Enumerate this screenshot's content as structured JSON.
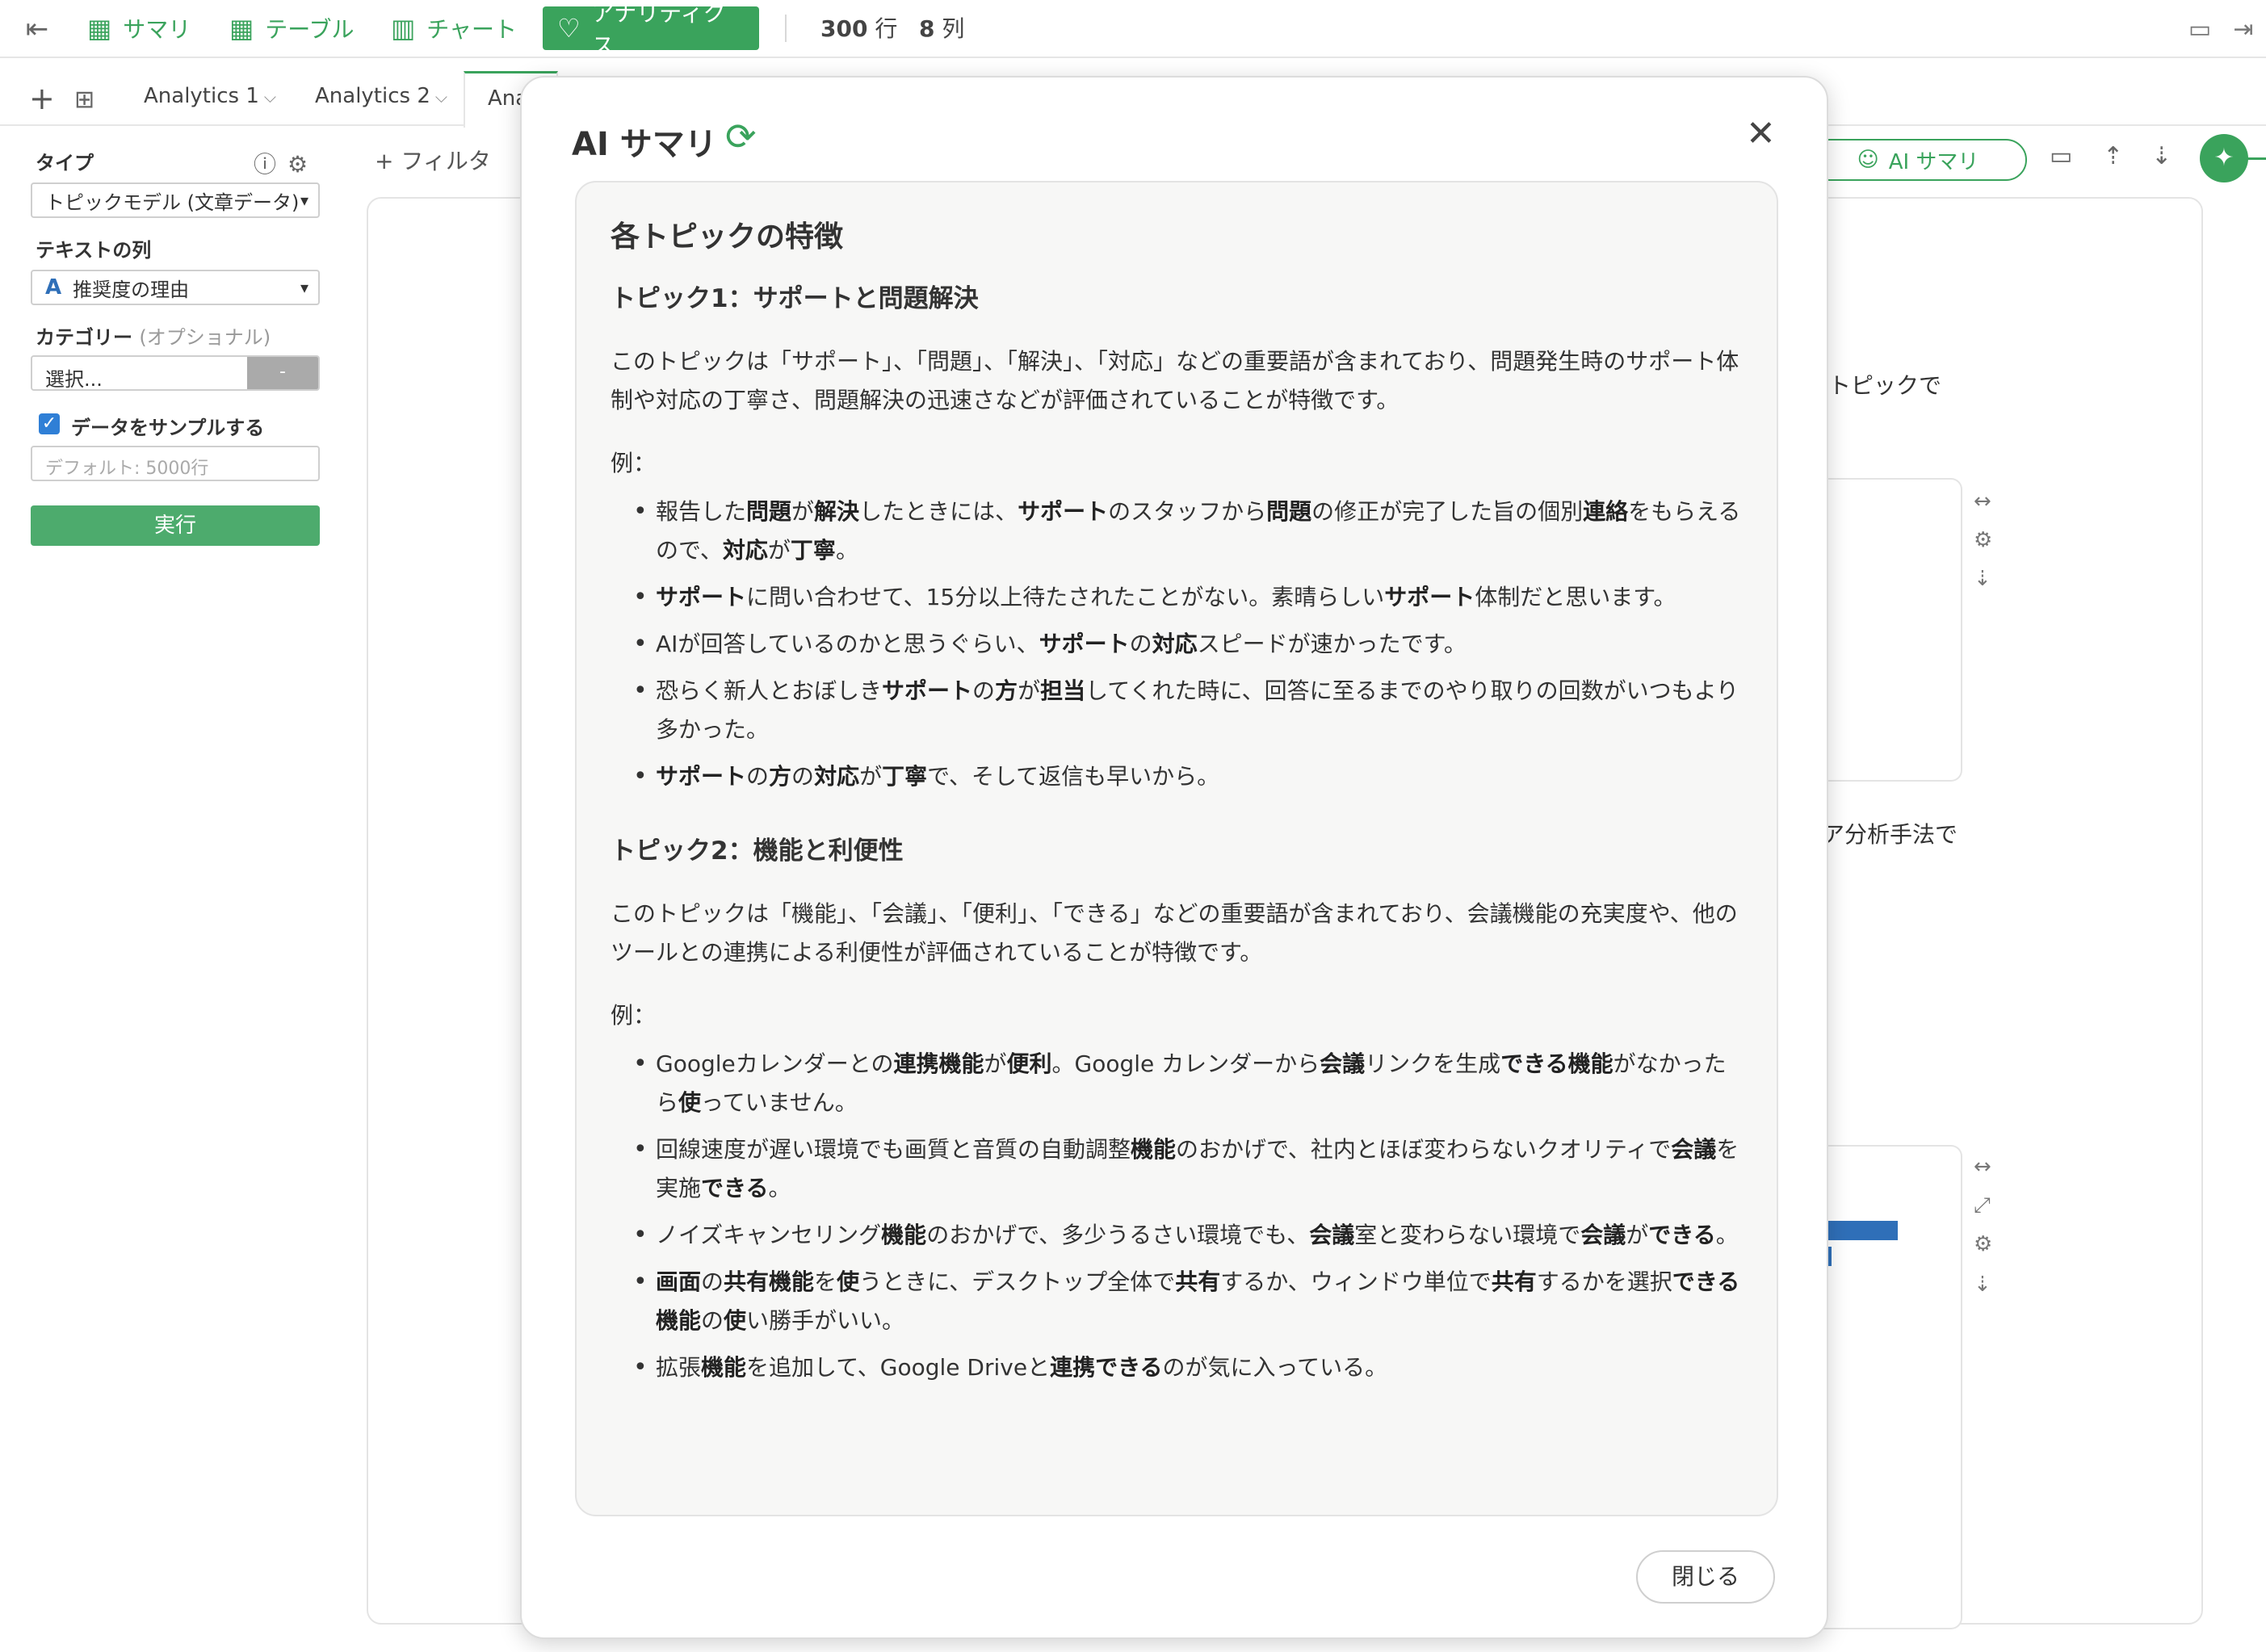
{
  "toolbar": {
    "tabs": [
      {
        "label": "サマリ",
        "icon": "table-icon"
      },
      {
        "label": "テーブル",
        "icon": "grid-icon"
      },
      {
        "label": "チャート",
        "icon": "bar-chart-icon"
      },
      {
        "label": "アナリティクス",
        "icon": "lightbulb-icon"
      }
    ],
    "rows": "300",
    "rows_unit": "行",
    "cols": "8",
    "cols_unit": "列"
  },
  "analytics_tabs": [
    "Analytics 1",
    "Analytics 2",
    "Anal"
  ],
  "config": {
    "type_label": "タイプ",
    "type_value": "トピックモデル (文章データ)",
    "text_col_label": "テキストの列",
    "text_col_value": "推奨度の理由",
    "category_label": "カテゴリー",
    "category_optional": "(オプショナル)",
    "category_placeholder": "選択...",
    "category_button": "-",
    "sample_label": "データをサンプルする",
    "sample_placeholder": "デフォルト: 5000行",
    "run_label": "実行"
  },
  "main": {
    "filter_label": "フィルタ",
    "ai_summary_button": "AI サマリ",
    "bg_text_1": "トピックで",
    "bg_text_2": "ア分析手法で"
  },
  "modal": {
    "title": "AI サマリ",
    "heading": "各トピックの特徴",
    "close_label": "閉じる",
    "topics": [
      {
        "title": "トピック1：サポートと問題解決",
        "desc": "このトピックは「サポート」、「問題」、「解決」、「対応」などの重要語が含まれており、問題発生時のサポート体制や対応の丁寧さ、問題解決の迅速さなどが評価されていることが特徴です。",
        "ex_label": "例：",
        "examples": [
          [
            [
              "報告した",
              false
            ],
            [
              "問題",
              true
            ],
            [
              "が",
              false
            ],
            [
              "解決",
              true
            ],
            [
              "したときには、",
              false
            ],
            [
              "サポート",
              true
            ],
            [
              "のスタッフから",
              false
            ],
            [
              "問題",
              true
            ],
            [
              "の修正が完了した旨の個別",
              false
            ],
            [
              "連絡",
              true
            ],
            [
              "をもらえるので、",
              false
            ],
            [
              "対応",
              true
            ],
            [
              "が",
              false
            ],
            [
              "丁寧",
              true
            ],
            [
              "。",
              false
            ]
          ],
          [
            [
              "サポート",
              true
            ],
            [
              "に問い合わせて、15分以上待たされたことがない。素晴らしい",
              false
            ],
            [
              "サポート",
              true
            ],
            [
              "体制だと思います。",
              false
            ]
          ],
          [
            [
              "AIが回答しているのかと思うぐらい、",
              false
            ],
            [
              "サポート",
              true
            ],
            [
              "の",
              false
            ],
            [
              "対応",
              true
            ],
            [
              "スピードが速かったです。",
              false
            ]
          ],
          [
            [
              "恐らく新人とおぼしき",
              false
            ],
            [
              "サポート",
              true
            ],
            [
              "の",
              false
            ],
            [
              "方",
              true
            ],
            [
              "が",
              false
            ],
            [
              "担当",
              true
            ],
            [
              "してくれた時に、回答に至るまでのやり取りの回数がいつもより多かった。",
              false
            ]
          ],
          [
            [
              "サポート",
              true
            ],
            [
              "の",
              false
            ],
            [
              "方",
              true
            ],
            [
              "の",
              false
            ],
            [
              "対応",
              true
            ],
            [
              "が",
              false
            ],
            [
              "丁寧",
              true
            ],
            [
              "で、そして返信も早いから。",
              false
            ]
          ]
        ]
      },
      {
        "title": "トピック2：機能と利便性",
        "desc": "このトピックは「機能」、「会議」、「便利」、「できる」などの重要語が含まれており、会議機能の充実度や、他のツールとの連携による利便性が評価されていることが特徴です。",
        "ex_label": "例：",
        "examples": [
          [
            [
              "Googleカレンダーとの",
              false
            ],
            [
              "連携機能",
              true
            ],
            [
              "が",
              false
            ],
            [
              "便利",
              true
            ],
            [
              "。Google カレンダーから",
              false
            ],
            [
              "会議",
              true
            ],
            [
              "リンクを生成",
              false
            ],
            [
              "できる機能",
              true
            ],
            [
              "がなかったら",
              false
            ],
            [
              "使",
              true
            ],
            [
              "っていません。",
              false
            ]
          ],
          [
            [
              "回線速度が遅い環境でも画質と音質の自動調整",
              false
            ],
            [
              "機能",
              true
            ],
            [
              "のおかげで、社内とほぼ変わらないクオリティで",
              false
            ],
            [
              "会議",
              true
            ],
            [
              "を実施",
              false
            ],
            [
              "できる",
              true
            ],
            [
              "。",
              false
            ]
          ],
          [
            [
              "ノイズキャンセリング",
              false
            ],
            [
              "機能",
              true
            ],
            [
              "のおかげで、多少うるさい環境でも、",
              false
            ],
            [
              "会議",
              true
            ],
            [
              "室と変わらない環境で",
              false
            ],
            [
              "会議",
              true
            ],
            [
              "が",
              false
            ],
            [
              "できる",
              true
            ],
            [
              "。",
              false
            ]
          ],
          [
            [
              "画面",
              true
            ],
            [
              "の",
              false
            ],
            [
              "共有機能",
              true
            ],
            [
              "を",
              false
            ],
            [
              "使",
              true
            ],
            [
              "うときに、デスクトップ全体で",
              false
            ],
            [
              "共有",
              true
            ],
            [
              "するか、ウィンドウ単位で",
              false
            ],
            [
              "共有",
              true
            ],
            [
              "するかを選択",
              false
            ],
            [
              "できる機能",
              true
            ],
            [
              "の",
              false
            ],
            [
              "使",
              true
            ],
            [
              "い勝手がいい。",
              false
            ]
          ],
          [
            [
              "拡張",
              false
            ],
            [
              "機能",
              true
            ],
            [
              "を追加して、Google Driveと",
              false
            ],
            [
              "連携できる",
              true
            ],
            [
              "のが気に入っている。",
              false
            ]
          ]
        ]
      }
    ]
  },
  "colors": {
    "accent": "#3aa35c",
    "bar": "#2f6fb8",
    "checkbox": "#2f7fd6"
  }
}
